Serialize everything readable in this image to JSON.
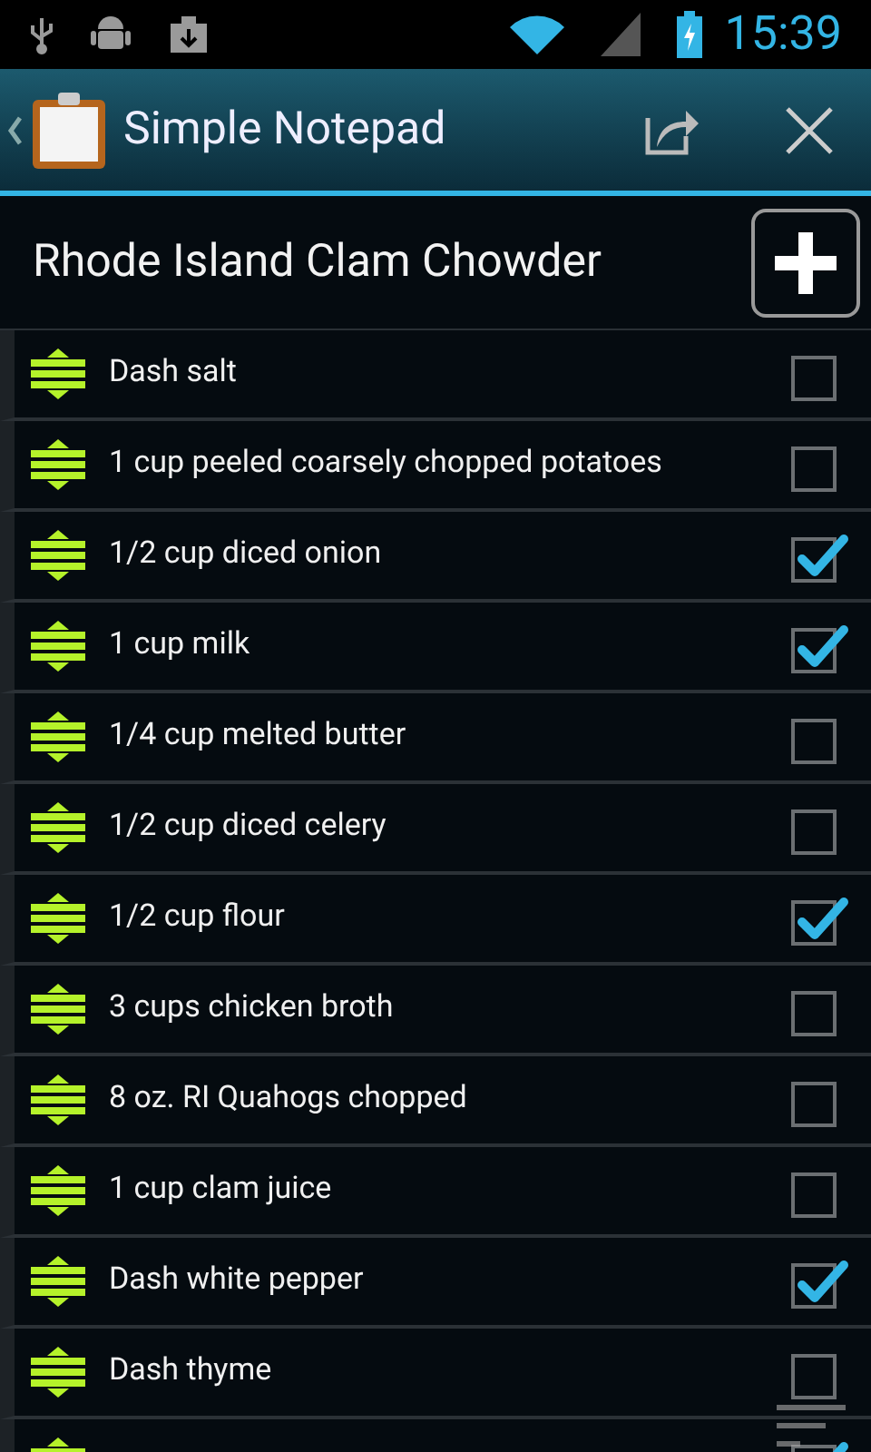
{
  "status_bar": {
    "time": "15:39"
  },
  "action_bar": {
    "title": "Simple Notepad"
  },
  "note": {
    "title": "Rhode Island Clam Chowder"
  },
  "items": [
    {
      "label": "Dash salt",
      "checked": false
    },
    {
      "label": "1 cup peeled coarsely chopped potatoes",
      "checked": false
    },
    {
      "label": "1/2 cup diced onion",
      "checked": true
    },
    {
      "label": "1 cup milk",
      "checked": true
    },
    {
      "label": "1/4 cup melted butter",
      "checked": false
    },
    {
      "label": "1/2 cup diced celery",
      "checked": false
    },
    {
      "label": "1/2 cup flour",
      "checked": true
    },
    {
      "label": "3 cups chicken broth",
      "checked": false
    },
    {
      "label": "8 oz. RI Quahogs chopped",
      "checked": false
    },
    {
      "label": "1 cup clam juice",
      "checked": false
    },
    {
      "label": "Dash white pepper",
      "checked": true
    },
    {
      "label": "Dash thyme",
      "checked": false
    },
    {
      "checked": true
    }
  ]
}
